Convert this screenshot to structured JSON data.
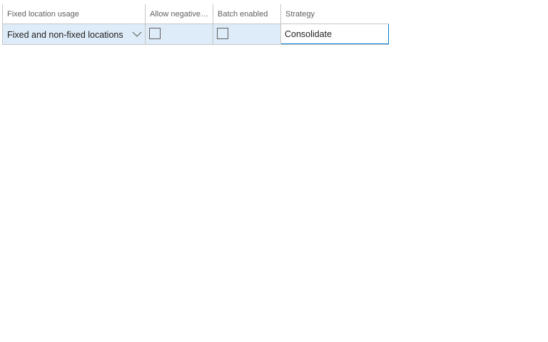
{
  "grid": {
    "columns": [
      {
        "label": "Fixed location usage"
      },
      {
        "label": "Allow negative inventory"
      },
      {
        "label": "Batch enabled"
      },
      {
        "label": "Strategy"
      }
    ],
    "row": {
      "fixed_location_usage": "Fixed and non-fixed locations",
      "allow_negative_inventory": false,
      "batch_enabled": false,
      "strategy": "Consolidate"
    }
  },
  "icons": {
    "dropdown": "chevron-down-icon"
  },
  "colors": {
    "selected_row": "#deecf9",
    "focus_border": "#0078d4",
    "grid_line": "#c8c6c4"
  }
}
